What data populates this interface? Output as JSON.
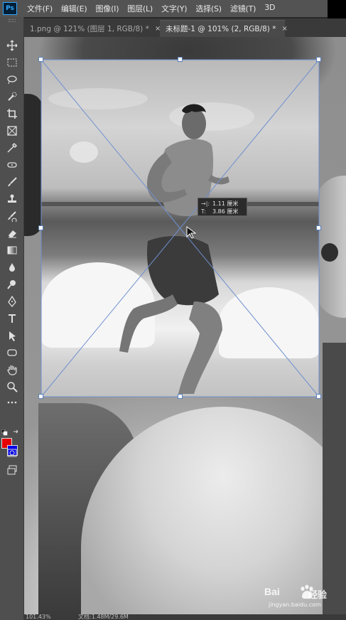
{
  "app": {
    "logo": "Ps"
  },
  "menu": [
    "文件(F)",
    "编辑(E)",
    "图像(I)",
    "图层(L)",
    "文字(Y)",
    "选择(S)",
    "滤镜(T)",
    "3D"
  ],
  "tabs": [
    {
      "label": "1.png @ 121% (图层 1, RGB/8) *",
      "close": "×",
      "active": false
    },
    {
      "label": "未标题-1 @ 101% (2, RGB/8) *",
      "close": "×",
      "active": true
    }
  ],
  "tools": [
    "move-tool-icon",
    "marquee-tool-icon",
    "lasso-tool-icon",
    "quick-select-tool-icon",
    "crop-tool-icon",
    "frame-tool-icon",
    "eyedropper-tool-icon",
    "healing-brush-tool-icon",
    "brush-tool-icon",
    "clone-stamp-tool-icon",
    "history-brush-tool-icon",
    "eraser-tool-icon",
    "gradient-tool-icon",
    "blur-tool-icon",
    "dodge-tool-icon",
    "pen-tool-icon",
    "type-tool-icon",
    "path-select-tool-icon",
    "shape-tool-icon",
    "hand-tool-icon",
    "zoom-tool-icon",
    "more-tools-icon"
  ],
  "colors": {
    "foreground": "#e60000",
    "background": "#0000e6",
    "accent": "#31a8ff"
  },
  "transform_readout": {
    "width_label": "→|:",
    "width_value": "1.11 厘米",
    "height_label": "T:",
    "height_value": "3.86 厘米"
  },
  "status": {
    "zoom": "101.43%",
    "doc": "文档:1.48M/29.6M"
  },
  "watermark": {
    "brand": "Bai",
    "brand_cn": "经验",
    "url": "jingyan.baidu.com"
  }
}
